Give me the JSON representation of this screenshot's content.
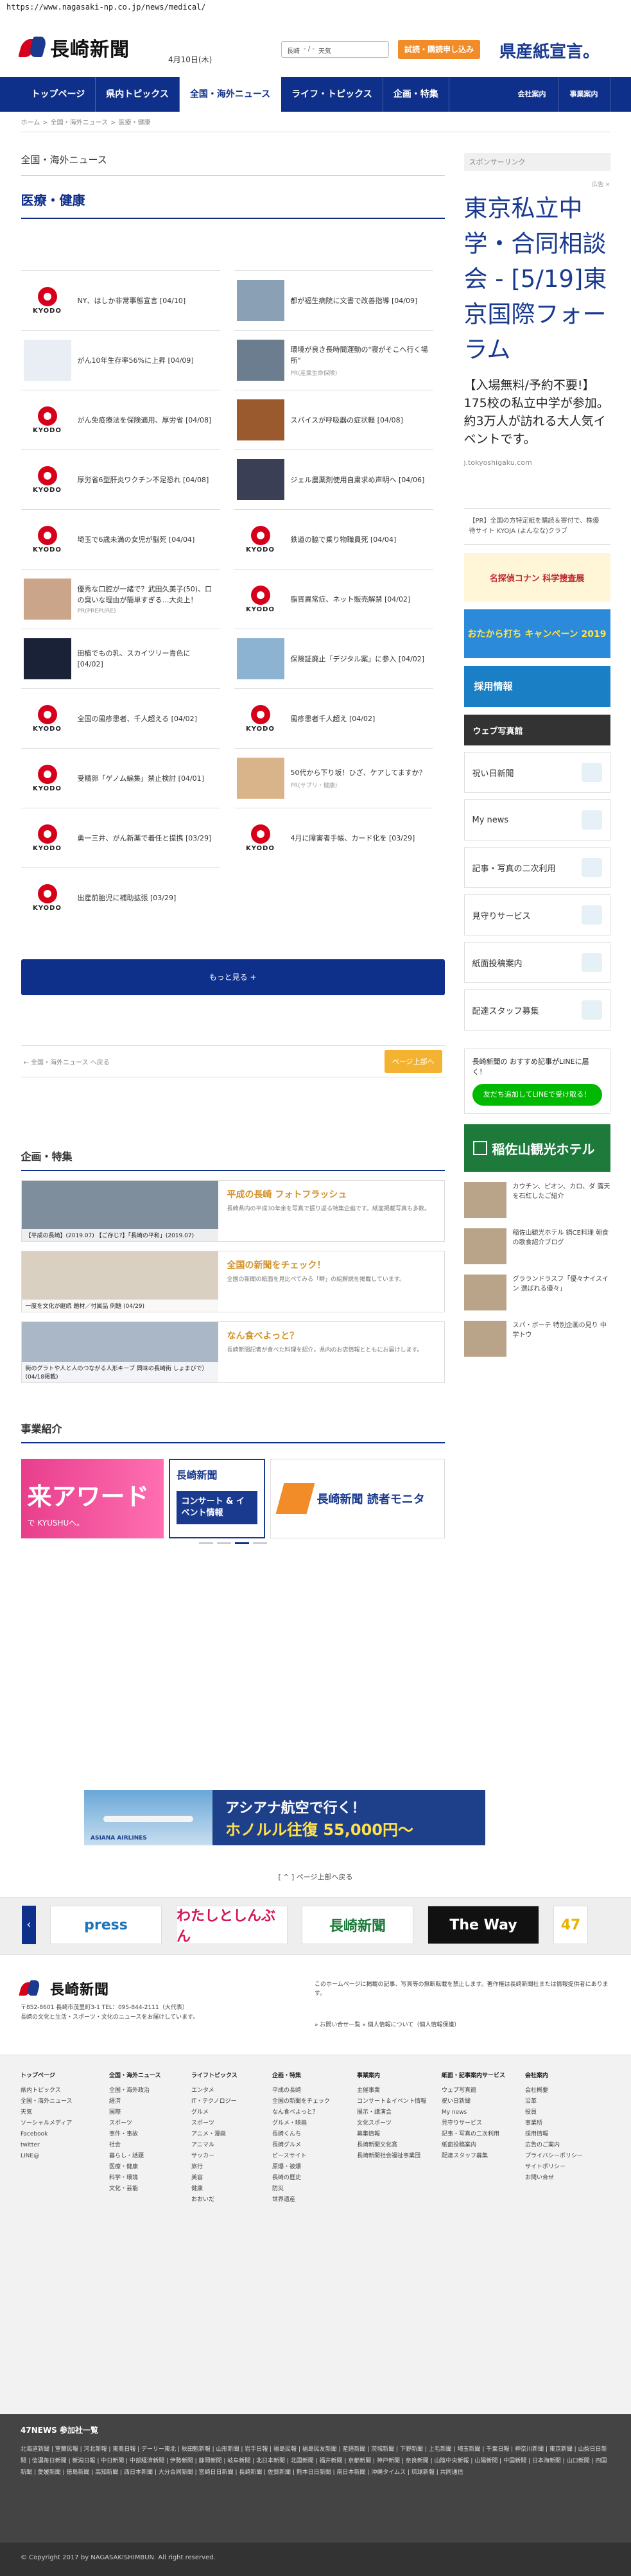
{
  "url": "https://www.nagasaki-np.co.jp/news/medical/",
  "header": {
    "logo_text": "長崎新聞",
    "date": "4月10日(木)",
    "weather_label": "長崎",
    "weather_value": "- / -",
    "weather_more": "天気",
    "trial_button": "試読・購読申し込み",
    "tagline": "県産紙宣言。"
  },
  "nav": {
    "items": [
      "トップページ",
      "県内トピックス",
      "全国・海外ニュース",
      "ライフ・トピックス",
      "企画・特集"
    ],
    "active_index": 2,
    "right_items": [
      "会社案内",
      "事業案内"
    ]
  },
  "breadcrumb": [
    "ホーム",
    ">",
    "全国・海外ニュース",
    ">",
    "医療・健康"
  ],
  "main": {
    "section_label": "全国・海外ニュース",
    "category_title": "医療・健康",
    "news": [
      {
        "title": "NY、はしか非常事態宣言 [04/10]",
        "thumb": "kyodo",
        "sub": ""
      },
      {
        "title": "都が福生病院に文書で改善指導 [04/09]",
        "thumb": "photo-building",
        "sub": ""
      },
      {
        "title": "がん10年生存率56%に上昇 [04/09]",
        "thumb": "photo-chart",
        "sub": ""
      },
      {
        "title": "環境が良き長時間運動の\"寝がそこへ行く場所\"",
        "thumb": "photo-person",
        "sub": "PR(産業生命保険)"
      },
      {
        "title": "がん免疫療法を保険適用、厚労省 [04/08]",
        "thumb": "kyodo",
        "sub": ""
      },
      {
        "title": "スパイスが呼吸器の症状軽 [04/08]",
        "thumb": "photo-spice",
        "sub": ""
      },
      {
        "title": "厚労省6型肝炎ワクチン不足恐れ [04/08]",
        "thumb": "kyodo",
        "sub": ""
      },
      {
        "title": "ジェル農薬剤使用自粛求め声明へ [04/06]",
        "thumb": "photo-dark",
        "sub": ""
      },
      {
        "title": "埼玉で6歳未満の女児が脳死 [04/04]",
        "thumb": "kyodo",
        "sub": ""
      },
      {
        "title": "鉄道の脇で乗り物職員死 [04/04]",
        "thumb": "kyodo",
        "sub": ""
      },
      {
        "title": "優秀な口腔が一緒で？武田久美子(50)、口の臭いな理由が簡単すぎる…大炎上！",
        "thumb": "photo-face",
        "sub": "PR(PREPURE)"
      },
      {
        "title": "脂質異常症、ネット販売解禁 [04/02]",
        "thumb": "kyodo",
        "sub": ""
      },
      {
        "title": "田植でもの乳、スカイツリー青色に [04/02]",
        "thumb": "photo-tower",
        "sub": ""
      },
      {
        "title": "保険証廃止「デジタル案」に参入 [04/02]",
        "thumb": "photo-tablet",
        "sub": ""
      },
      {
        "title": "全国の風疹患者、千人超える [04/02]",
        "thumb": "kyodo",
        "sub": ""
      },
      {
        "title": "風疹患者千人超え [04/02]",
        "thumb": "kyodo",
        "sub": ""
      },
      {
        "title": "受精卵「ゲノム編集」禁止検討 [04/01]",
        "thumb": "kyodo",
        "sub": ""
      },
      {
        "title": "50代から下り坂！ひざ、ケアしてますか？",
        "thumb": "photo-knee",
        "sub": "PR(サプリ・健康)"
      },
      {
        "title": "勇一三井、がん新薬で着任と提携 [03/29]",
        "thumb": "kyodo",
        "sub": ""
      },
      {
        "title": "4月に障害者手帳、カード化を [03/29]",
        "thumb": "kyodo",
        "sub": ""
      },
      {
        "title": "出産前胎児に補助拡張 [03/29]",
        "thumb": "kyodo",
        "sub": ""
      }
    ],
    "kyodo_label": "KYODO",
    "more_button": "もっと見る +",
    "back_link": "← 全国・海外ニュース へ戻る",
    "to_top": "ページ上部へ"
  },
  "features": {
    "title": "企画・特集",
    "rows": [
      {
        "caption": "【平成の長崎】(2019.07)  【ご存じ?】「長崎の平和」(2019.07)",
        "head": "平成の長崎 フォトフラッシュ",
        "desc": "長崎県内の平成30年余を写真で振り返る特集企画です。紙面掲載写真も多数。"
      },
      {
        "caption": "一度を文化が継続  題材／付属品 例題 (04/29)",
        "head": "全国の新聞をチェック！",
        "desc": "全国の新聞の紙面を見比べてみる「瞬」の紹解説を掲載しています。"
      },
      {
        "caption": "街のグラトや人と人のつながる人形キーブ  興味の長崎街  しょまびで）(04/18掲載)",
        "head": "なん食べよっと？",
        "desc": "長崎新聞記者が食べた料理を紹介。県内のお店情報とともにお届けします。"
      }
    ]
  },
  "business": {
    "title": "事業紹介",
    "slide1": "来アワード",
    "slide1_sub": "で KYUSHUへ。",
    "slide2_logo": "長崎新聞",
    "slide2_text": "コンサート & イベント情報",
    "slide3_text": "長崎新聞 読者モニタ"
  },
  "sidebar": {
    "sponsor_label": "スポンサーリンク",
    "ad_close": "広告 ×",
    "ad_headline": "東京私立中学・合同相談会 - [5/19]東京国際フォーラム",
    "ad_text": "【入場無料/予約不要!】175校の私立中学が参加。約3万人が訪れる大人気イベントです。",
    "ad_url": "j.tokyoshigaku.com",
    "pr_text": "【PR】全国の方特定紙を購読＆寄付で、株優待サイト KYOJA (よんなな)クラブ",
    "banner1": "名探偵コナン 科学捜査展",
    "banner2": "おたから打ち キャンペーン 2019",
    "recruit": "採用情報",
    "web_newspaper": "ウェブ写真館",
    "rows": [
      "祝い日新聞",
      "My news",
      "記事・写真の二次利用",
      "見守りサービス",
      "紙面投稿案内",
      "配達スタッフ募集"
    ],
    "line_text": "長崎新聞の おすすめ記事がLINEに届く！",
    "line_button": "友だち追加してLINEで受け取る！",
    "hotel_name": "稲佐山観光ホテル",
    "hotel_items": [
      "カウチン、ピオン、カロ、ダ 露天を石紅したご紹介",
      "稲佐山観光ホテル 鍋CE料理 朝食の歌食紹介ブログ",
      "グラランドラスフ「優々ナイスイン 選ばれる優々」",
      "スパ・ボーテ 特別企画の見り 中学トウ"
    ]
  },
  "big_ad": {
    "line1": "アシアナ航空で行く！",
    "line2": "ホノルル往復 55,000円〜",
    "brand": "ASIANA AIRLINES"
  },
  "close_bar": "[ ^ ] ページ上部へ戻る",
  "partners": [
    "press",
    "わたしとしんぶん",
    "長崎新聞",
    "The Way",
    "47"
  ],
  "footer": {
    "logo": "長崎新聞",
    "address": "〒852-8601 長崎市茂里町3-1  TEL：095-844-2111（大代表）",
    "address2": "長崎の文化と生活・スポーツ・文化のニュースをお届けしています。",
    "notice": "このホームページに掲載の記事、写真等の無断転載を禁止します。著作権は長崎新聞社または情報提供者にあります。",
    "links": "» お問い合せ一覧    » 個人情報について（個人情報保護）",
    "sitemap": [
      {
        "head": "トップページ",
        "items": [
          "県内トピックス",
          "全国・海外ニュース",
          "天気",
          "ソーシャルメディア",
          "Facebook",
          "twitter",
          "LINE@"
        ]
      },
      {
        "head": "全国・海外ニュース",
        "items": [
          "全国・海外政治",
          "経済",
          "国際",
          "スポーツ",
          "事件・事故",
          "社会",
          "暮らし・話題",
          "医療・健康",
          "科学・環境",
          "文化・芸能"
        ]
      },
      {
        "head": "ライフトピックス",
        "items": [
          "エンタメ",
          "IT・テクノロジー",
          "グルメ",
          "スポーツ",
          "アニメ・漫画",
          "アニマル",
          "サッカー",
          "旅行",
          "美容",
          "健康",
          "おおいだ"
        ]
      },
      {
        "head": "企画・特集",
        "items": [
          "平成の長崎",
          "全国の新聞をチェック",
          "なん食べよっと？",
          "グルメ・映画",
          "長崎くんち",
          "長崎グルメ",
          "ピースサイト",
          "原爆・被爆",
          "長崎の歴史",
          "防災",
          "世界遺産"
        ]
      },
      {
        "head": "事業案内",
        "items": [
          "主催事業",
          "コンサート＆イベント情報",
          "展示・講演会",
          "文化スポーツ",
          "募集情報",
          "長崎新聞文化賞",
          "長崎新聞社会福祉事業団"
        ]
      },
      {
        "head": "紙面・記事案内サービス",
        "items": [
          "ウェブ写真館",
          "祝い日新聞",
          "My news",
          "見守りサービス",
          "記事・写真の二次利用",
          "紙面投稿案内",
          "配達スタッフ募集"
        ]
      },
      {
        "head": "会社案内",
        "items": [
          "会社概要",
          "沿革",
          "役員",
          "事業所",
          "採用情報",
          "広告のご案内",
          "プライバシーポリシー",
          "サイトポリシー",
          "お問い合せ"
        ]
      }
    ]
  },
  "news47": {
    "title": "47NEWS 参加社一覧",
    "members": "北海道新聞 | 室蘭民報 | 河北新報 | 東奥日報 | デーリー東北 | 秋田魁新報 | 山形新聞 | 岩手日報 | 福島民報 | 福島民友新聞 | 産経新聞 | 茨城新聞 | 下野新聞 | 上毛新聞 | 埼玉新聞 | 千葉日報 | 神奈川新聞 | 東京新聞 | 山梨日日新聞 | 信濃毎日新聞 | 新潟日報 | 中日新聞 | 中部経済新聞 | 伊勢新聞 | 静岡新聞 | 岐阜新聞 | 北日本新聞 | 北國新聞 | 福井新聞 | 京都新聞 | 神戸新聞 | 奈良新聞 | 山陰中央新報 | 山陽新聞 | 中国新聞 | 日本海新聞 | 山口新聞 | 四国新聞 | 愛媛新聞 | 徳島新聞 | 高知新聞 | 西日本新聞 | 大分合同新聞 | 宮崎日日新聞 | 長崎新聞 | 佐賀新聞 | 熊本日日新聞 | 南日本新聞 | 沖縄タイムス | 琉球新報 | 共同通信"
  },
  "copyright": "© Copyright 2017 by NAGASAKISHIMBUN. All right reserved."
}
